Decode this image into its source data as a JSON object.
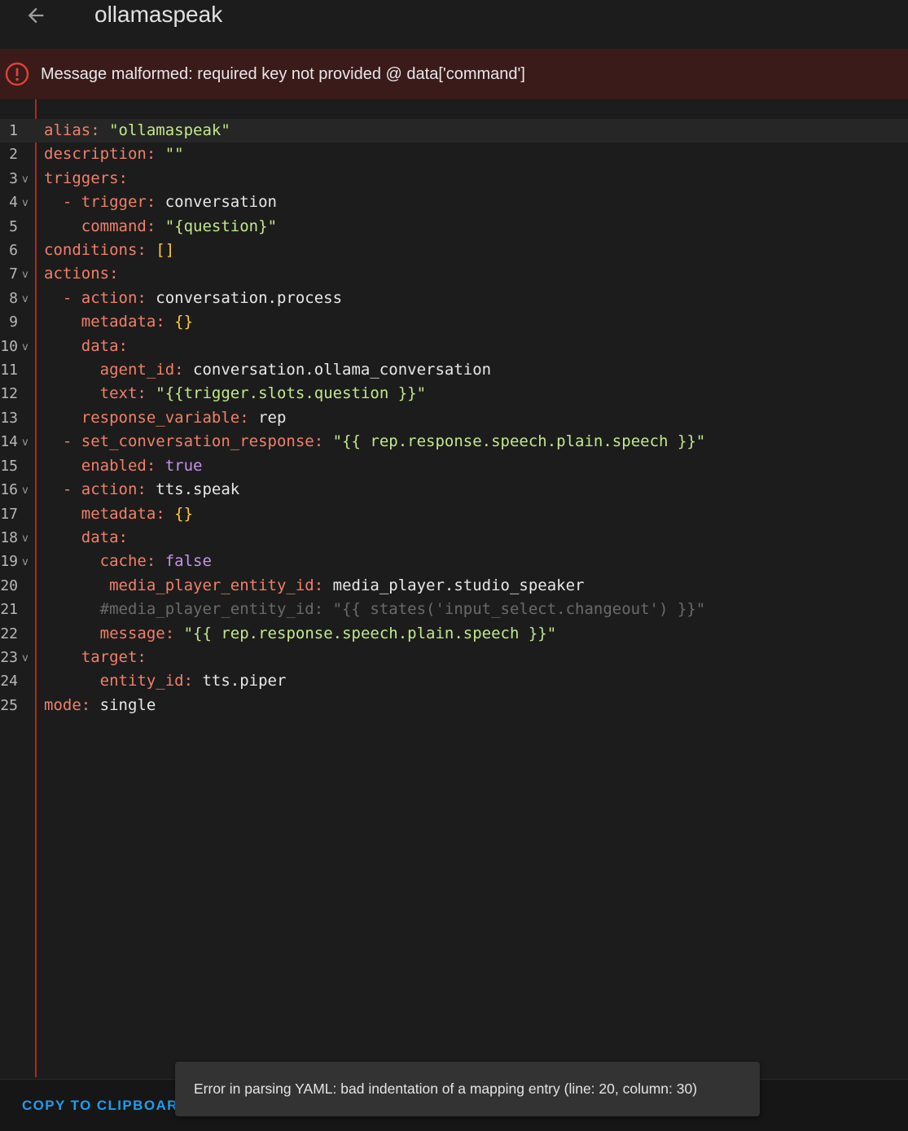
{
  "header": {
    "title": "ollamaspeak",
    "back_icon": "arrow-left-icon"
  },
  "error_banner": {
    "icon": "alert-circle-icon",
    "message": "Message malformed: required key not provided @ data['command']",
    "color": "#db4437"
  },
  "editor": {
    "lines": [
      {
        "n": "1",
        "fold": false,
        "parts": [
          [
            "k",
            "alias:"
          ],
          [
            "w",
            " "
          ],
          [
            "s",
            "\"ollamaspeak\""
          ]
        ]
      },
      {
        "n": "2",
        "fold": false,
        "parts": [
          [
            "k",
            "description:"
          ],
          [
            "w",
            " "
          ],
          [
            "s",
            "\"\""
          ]
        ]
      },
      {
        "n": "3",
        "fold": true,
        "parts": [
          [
            "k",
            "triggers:"
          ]
        ]
      },
      {
        "n": "4",
        "fold": true,
        "parts": [
          [
            "w",
            "  "
          ],
          [
            "k",
            "- trigger:"
          ],
          [
            "w",
            " conversation"
          ]
        ]
      },
      {
        "n": "5",
        "fold": false,
        "parts": [
          [
            "w",
            "    "
          ],
          [
            "k",
            "command:"
          ],
          [
            "w",
            " "
          ],
          [
            "s",
            "\"{question}\""
          ]
        ]
      },
      {
        "n": "6",
        "fold": false,
        "parts": [
          [
            "k",
            "conditions:"
          ],
          [
            "w",
            " "
          ],
          [
            "p",
            "[]"
          ]
        ]
      },
      {
        "n": "7",
        "fold": true,
        "parts": [
          [
            "k",
            "actions:"
          ]
        ]
      },
      {
        "n": "8",
        "fold": true,
        "parts": [
          [
            "w",
            "  "
          ],
          [
            "k",
            "- action:"
          ],
          [
            "w",
            " conversation.process"
          ]
        ]
      },
      {
        "n": "9",
        "fold": false,
        "parts": [
          [
            "w",
            "    "
          ],
          [
            "k",
            "metadata:"
          ],
          [
            "w",
            " "
          ],
          [
            "p",
            "{}"
          ]
        ]
      },
      {
        "n": "10",
        "fold": true,
        "parts": [
          [
            "w",
            "    "
          ],
          [
            "k",
            "data:"
          ]
        ]
      },
      {
        "n": "11",
        "fold": false,
        "parts": [
          [
            "w",
            "      "
          ],
          [
            "k",
            "agent_id:"
          ],
          [
            "w",
            " conversation.ollama_conversation"
          ]
        ]
      },
      {
        "n": "12",
        "fold": false,
        "parts": [
          [
            "w",
            "      "
          ],
          [
            "k",
            "text:"
          ],
          [
            "w",
            " "
          ],
          [
            "s",
            "\"{{trigger.slots.question }}\""
          ]
        ]
      },
      {
        "n": "13",
        "fold": false,
        "parts": [
          [
            "w",
            "    "
          ],
          [
            "k",
            "response_variable:"
          ],
          [
            "w",
            " rep"
          ]
        ]
      },
      {
        "n": "14",
        "fold": true,
        "parts": [
          [
            "w",
            "  "
          ],
          [
            "k",
            "- set_conversation_response:"
          ],
          [
            "w",
            " "
          ],
          [
            "s",
            "\"{{ rep.response.speech.plain.speech }}\""
          ]
        ]
      },
      {
        "n": "15",
        "fold": false,
        "parts": [
          [
            "w",
            "    "
          ],
          [
            "k",
            "enabled:"
          ],
          [
            "w",
            " "
          ],
          [
            "b",
            "true"
          ]
        ]
      },
      {
        "n": "16",
        "fold": true,
        "parts": [
          [
            "w",
            "  "
          ],
          [
            "k",
            "- action:"
          ],
          [
            "w",
            " tts.speak"
          ]
        ]
      },
      {
        "n": "17",
        "fold": false,
        "parts": [
          [
            "w",
            "    "
          ],
          [
            "k",
            "metadata:"
          ],
          [
            "w",
            " "
          ],
          [
            "p",
            "{}"
          ]
        ]
      },
      {
        "n": "18",
        "fold": true,
        "parts": [
          [
            "w",
            "    "
          ],
          [
            "k",
            "data:"
          ]
        ]
      },
      {
        "n": "19",
        "fold": true,
        "parts": [
          [
            "w",
            "      "
          ],
          [
            "k",
            "cache:"
          ],
          [
            "w",
            " "
          ],
          [
            "b",
            "false"
          ]
        ]
      },
      {
        "n": "20",
        "fold": false,
        "parts": [
          [
            "w",
            "       "
          ],
          [
            "k",
            "media_player_entity_id:"
          ],
          [
            "w",
            " media_player.studio_speaker"
          ]
        ]
      },
      {
        "n": "21",
        "fold": false,
        "parts": [
          [
            "w",
            "      "
          ],
          [
            "c",
            "#media_player_entity_id: \"{{ states('input_select.changeout') }}\""
          ]
        ]
      },
      {
        "n": "22",
        "fold": false,
        "parts": [
          [
            "w",
            "      "
          ],
          [
            "k",
            "message:"
          ],
          [
            "w",
            " "
          ],
          [
            "s",
            "\"{{ rep.response.speech.plain.speech }}\""
          ]
        ]
      },
      {
        "n": "23",
        "fold": true,
        "parts": [
          [
            "w",
            "    "
          ],
          [
            "k",
            "target:"
          ]
        ]
      },
      {
        "n": "24",
        "fold": false,
        "parts": [
          [
            "w",
            "      "
          ],
          [
            "k",
            "entity_id:"
          ],
          [
            "w",
            " tts.piper"
          ]
        ]
      },
      {
        "n": "25",
        "fold": false,
        "parts": [
          [
            "k",
            "mode:"
          ],
          [
            "w",
            " single"
          ]
        ]
      }
    ]
  },
  "footer": {
    "copy_label": "COPY TO CLIPBOAR"
  },
  "toast": {
    "message": "Error in parsing YAML: bad indentation of a mapping entry (line: 20, column: 30)"
  }
}
